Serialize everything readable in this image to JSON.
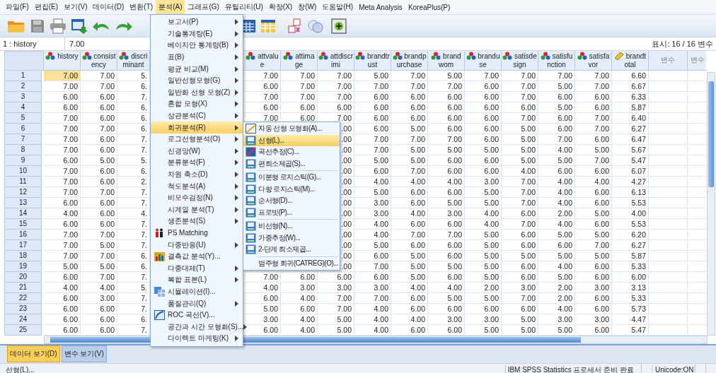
{
  "menubar": [
    {
      "label": "파일(F)",
      "selected": false
    },
    {
      "label": "편집(E)",
      "selected": false
    },
    {
      "label": "보기(V)",
      "selected": false
    },
    {
      "label": "데이터(D)",
      "selected": false
    },
    {
      "label": "변환(T)",
      "selected": false
    },
    {
      "label": "분석(A)",
      "selected": true
    },
    {
      "label": "그래프(G)",
      "selected": false
    },
    {
      "label": "유틸리티(U)",
      "selected": false
    },
    {
      "label": "확장(X)",
      "selected": false
    },
    {
      "label": "창(W)",
      "selected": false
    },
    {
      "label": "도움말(H)",
      "selected": false
    },
    {
      "label": "Meta Analysis",
      "selected": false
    },
    {
      "label": "KoreaPlus(P)",
      "selected": false
    }
  ],
  "cell_editor": {
    "ref": "1 : history",
    "value": "7.00",
    "display_count": "표시: 16 / 16 변수"
  },
  "columns": [
    {
      "label": "history",
      "kind": "nominal"
    },
    {
      "label": "consistency",
      "kind": "nominal"
    },
    {
      "label": "discriminant",
      "kind": "nominal"
    },
    {
      "label": "attvalue",
      "kind": "nominal"
    },
    {
      "label": "attimage",
      "kind": "nominal"
    },
    {
      "label": "attdiscrimi",
      "kind": "nominal"
    },
    {
      "label": "brandtrust",
      "kind": "nominal"
    },
    {
      "label": "brandpurchase",
      "kind": "nominal"
    },
    {
      "label": "brandwom",
      "kind": "nominal"
    },
    {
      "label": "branduse",
      "kind": "nominal"
    },
    {
      "label": "satisdesign",
      "kind": "nominal"
    },
    {
      "label": "satisfunction",
      "kind": "nominal"
    },
    {
      "label": "satisfavor",
      "kind": "nominal"
    },
    {
      "label": "brandtotal",
      "kind": "scale"
    },
    {
      "label": "변수",
      "kind": "empty"
    },
    {
      "label": "변수",
      "kind": "empty"
    }
  ],
  "rows": [
    {
      "num": "1",
      "selected": true,
      "cells": [
        "7.00",
        "7.00",
        "5.",
        "7.00",
        "7.00",
        "7.00",
        "5.00",
        "7.00",
        "5.00",
        "7.00",
        "7.00",
        "7.00",
        "7.00",
        "6.60"
      ]
    },
    {
      "num": "2",
      "selected": false,
      "cells": [
        "7.00",
        "7.00",
        "6.",
        "6.00",
        "7.00",
        "7.00",
        "7.00",
        "7.00",
        "7.00",
        "6.00",
        "7.00",
        "5.00",
        "7.00",
        "6.67"
      ]
    },
    {
      "num": "3",
      "selected": false,
      "cells": [
        "6.00",
        "6.00",
        "7.",
        "7.00",
        "7.00",
        "7.00",
        "6.00",
        "6.00",
        "6.00",
        "6.00",
        "7.00",
        "6.00",
        "6.00",
        "6.33"
      ]
    },
    {
      "num": "4",
      "selected": false,
      "cells": [
        "6.00",
        "6.00",
        "6.",
        "6.00",
        "6.00",
        "6.00",
        "6.00",
        "6.00",
        "6.00",
        "6.00",
        "6.00",
        "5.00",
        "6.00",
        "5.87"
      ]
    },
    {
      "num": "5",
      "selected": false,
      "cells": [
        "7.00",
        "6.00",
        "6.",
        "7.00",
        "6.00",
        "7.00",
        "6.00",
        "6.00",
        "6.00",
        "6.00",
        "7.00",
        "6.00",
        "7.00",
        "6.40"
      ]
    },
    {
      "num": "6",
      "selected": false,
      "cells": [
        "7.00",
        "7.00",
        "6.",
        null,
        null,
        ".00",
        "6.00",
        "5.00",
        "6.00",
        "6.00",
        "5.00",
        "6.00",
        "7.00",
        "6.27"
      ]
    },
    {
      "num": "7",
      "selected": false,
      "cells": [
        "7.00",
        "6.00",
        "7.",
        null,
        null,
        ".00",
        "7.00",
        "7.00",
        "7.00",
        "6.00",
        "5.00",
        "7.00",
        "6.00",
        "6.47"
      ]
    },
    {
      "num": "8",
      "selected": false,
      "cells": [
        "7.00",
        "6.00",
        "7.",
        null,
        null,
        ".00",
        "7.00",
        "5.00",
        "5.00",
        "5.00",
        "5.00",
        "4.00",
        "5.00",
        "5.67"
      ]
    },
    {
      "num": "9",
      "selected": false,
      "cells": [
        "6.00",
        "5.00",
        "5.",
        null,
        null,
        ".00",
        "5.00",
        "5.00",
        "6.00",
        "6.00",
        "5.00",
        "5.00",
        "7.00",
        "5.47"
      ]
    },
    {
      "num": "10",
      "selected": false,
      "cells": [
        "7.00",
        "6.00",
        "6.",
        null,
        null,
        ".00",
        "6.00",
        "7.00",
        "6.00",
        "6.00",
        "4.00",
        "6.00",
        "6.00",
        "6.07"
      ]
    },
    {
      "num": "11",
      "selected": false,
      "cells": [
        "7.00",
        "6.00",
        "2.",
        null,
        null,
        ".00",
        "4.00",
        "4.00",
        "4.00",
        "3.00",
        "7.00",
        "4.00",
        "4.00",
        "4.27"
      ]
    },
    {
      "num": "12",
      "selected": false,
      "cells": [
        "7.00",
        "7.00",
        "7.",
        null,
        null,
        ".00",
        "5.00",
        "6.00",
        "6.00",
        "5.00",
        "7.00",
        "4.00",
        "6.00",
        "6.13"
      ]
    },
    {
      "num": "13",
      "selected": false,
      "cells": [
        "6.00",
        "6.00",
        "7.",
        null,
        null,
        ".00",
        "3.00",
        "6.00",
        "5.00",
        "5.00",
        "7.00",
        "4.00",
        "6.00",
        "5.53"
      ]
    },
    {
      "num": "14",
      "selected": false,
      "cells": [
        "4.00",
        "6.00",
        "4.",
        null,
        null,
        ".00",
        "3.00",
        "4.00",
        "3.00",
        "4.00",
        "6.00",
        "2.00",
        "5.00",
        "4.00"
      ]
    },
    {
      "num": "15",
      "selected": false,
      "cells": [
        "6.00",
        "6.00",
        "7.",
        null,
        null,
        ".00",
        "4.00",
        "6.00",
        "6.00",
        "4.00",
        "7.00",
        "4.00",
        "6.00",
        "5.53"
      ]
    },
    {
      "num": "16",
      "selected": false,
      "cells": [
        "7.00",
        "7.00",
        "7.",
        null,
        null,
        ".00",
        "4.00",
        "7.00",
        "7.00",
        "5.00",
        "6.00",
        "5.00",
        "5.00",
        "6.20"
      ]
    },
    {
      "num": "17",
      "selected": false,
      "cells": [
        "7.00",
        "5.00",
        "7.",
        null,
        null,
        ".00",
        "5.00",
        "6.00",
        "6.00",
        "5.00",
        "6.00",
        "6.00",
        "7.00",
        "6.27"
      ]
    },
    {
      "num": "18",
      "selected": false,
      "cells": [
        "7.00",
        "7.00",
        "6.",
        null,
        null,
        ".00",
        "6.00",
        "5.00",
        "6.00",
        "5.00",
        "5.00",
        "5.00",
        "5.00",
        "5.87"
      ]
    },
    {
      "num": "19",
      "selected": false,
      "cells": [
        "5.00",
        "5.00",
        "6.",
        null,
        null,
        ".00",
        "7.00",
        "5.00",
        "5.00",
        "5.00",
        "6.00",
        "4.00",
        "6.00",
        "5.33"
      ]
    },
    {
      "num": "20",
      "selected": false,
      "cells": [
        "6.00",
        "7.00",
        "7.",
        "7.00",
        "6.00",
        "6.00",
        "6.00",
        "5.00",
        "6.00",
        "5.00",
        "6.00",
        "5.00",
        "6.00",
        "6.00"
      ]
    },
    {
      "num": "21",
      "selected": false,
      "cells": [
        "4.00",
        "4.00",
        "5.",
        "4.00",
        "3.00",
        "3.00",
        "3.00",
        "4.00",
        "4.00",
        "2.00",
        "3.00",
        "2.00",
        "3.00",
        "3.13"
      ]
    },
    {
      "num": "22",
      "selected": false,
      "cells": [
        "6.00",
        "3.00",
        "7.",
        "6.00",
        "4.00",
        "7.00",
        "7.00",
        "6.00",
        "5.00",
        "5.00",
        "7.00",
        "2.00",
        "6.00",
        "5.33"
      ]
    },
    {
      "num": "23",
      "selected": false,
      "cells": [
        "6.00",
        "6.00",
        "7.",
        "5.00",
        "6.00",
        "7.00",
        "4.00",
        "6.00",
        "6.00",
        "6.00",
        "6.00",
        "4.00",
        "6.00",
        "5.73"
      ]
    },
    {
      "num": "24",
      "selected": false,
      "cells": [
        "6.00",
        "6.00",
        "6.",
        "3.00",
        "4.00",
        "5.00",
        "4.00",
        "4.00",
        "3.00",
        "3.00",
        "5.00",
        "3.00",
        "3.00",
        "4.47"
      ]
    },
    {
      "num": "25",
      "selected": false,
      "cells": [
        "6.00",
        "6.00",
        "7.",
        "6.00",
        "4.00",
        "5.00",
        "4.00",
        "6.00",
        "6.00",
        "5.00",
        "5.00",
        "5.00",
        "6.00",
        "5.47"
      ]
    }
  ],
  "analyze_menu": [
    {
      "label": "보고서(P)",
      "kind": "submenu",
      "selected": false
    },
    {
      "label": "기술통계량(E)",
      "kind": "submenu",
      "selected": false
    },
    {
      "label": "베이지안 통계량(B)",
      "kind": "submenu",
      "selected": false
    },
    {
      "label": "표(B)",
      "kind": "submenu",
      "selected": false
    },
    {
      "label": "평균 비교(M)",
      "kind": "submenu",
      "selected": false
    },
    {
      "label": "일반선형모형(G)",
      "kind": "submenu",
      "selected": false
    },
    {
      "label": "일반화 선형 모형(Z)",
      "kind": "submenu",
      "selected": false
    },
    {
      "label": "혼합 모형(X)",
      "kind": "submenu",
      "selected": false
    },
    {
      "label": "상관분석(C)",
      "kind": "submenu",
      "selected": false
    },
    {
      "label": "회귀분석(R)",
      "kind": "submenu",
      "selected": true
    },
    {
      "label": "로그선형분석(O)",
      "kind": "submenu",
      "selected": false
    },
    {
      "label": "신경망(W)",
      "kind": "submenu",
      "selected": false
    },
    {
      "label": "분류분석(F)",
      "kind": "submenu",
      "selected": false
    },
    {
      "label": "차원 축소(D)",
      "kind": "submenu",
      "selected": false
    },
    {
      "label": "척도분석(A)",
      "kind": "submenu",
      "selected": false
    },
    {
      "label": "비모수검정(N)",
      "kind": "submenu",
      "selected": false
    },
    {
      "label": "시계열 분석(T)",
      "kind": "submenu",
      "selected": false
    },
    {
      "label": "생존분석(S)",
      "kind": "submenu",
      "selected": false
    },
    {
      "label": "PS Matching",
      "kind": "people",
      "selected": false
    },
    {
      "label": "다중반응(U)",
      "kind": "submenu",
      "selected": false
    },
    {
      "label": "결측값 분석(Y)...",
      "kind": "chart",
      "selected": false
    },
    {
      "label": "다중대체(T)",
      "kind": "submenu",
      "selected": false
    },
    {
      "label": "복합 표본(L)",
      "kind": "submenu",
      "selected": false
    },
    {
      "label": "시뮬레이션(I)...",
      "kind": "grid",
      "selected": false
    },
    {
      "label": "품질관리(Q)",
      "kind": "submenu",
      "selected": false
    },
    {
      "label": "ROC 곡선(V)...",
      "kind": "curve",
      "selected": false
    },
    {
      "label": "공간과 시간 모형화(S)...",
      "kind": "submenu",
      "selected": false
    },
    {
      "label": "다이렉트 마케팅(K)",
      "kind": "submenu",
      "selected": false
    }
  ],
  "regression_menu": [
    {
      "label": "자동 선형 모형화(A)...",
      "kind": "line",
      "separator_before": false,
      "selected": false
    },
    {
      "label": "선형(L)...",
      "kind": "panel",
      "separator_before": false,
      "selected": true
    },
    {
      "label": "곡선추정(C)...",
      "kind": "curve",
      "separator_before": false,
      "selected": false
    },
    {
      "label": "편최소제곱(S)...",
      "kind": "panel",
      "separator_before": false,
      "selected": false
    },
    {
      "label": "이분형 로지스틱(G)...",
      "kind": "panel",
      "separator_before": true,
      "selected": false
    },
    {
      "label": "다항 로지스틱(M)...",
      "kind": "panel",
      "separator_before": false,
      "selected": false
    },
    {
      "label": "순서형(D)...",
      "kind": "panel",
      "separator_before": false,
      "selected": false
    },
    {
      "label": "프로빗(P)...",
      "kind": "panel",
      "separator_before": false,
      "selected": false
    },
    {
      "label": "비선형(N)...",
      "kind": "panel",
      "separator_before": true,
      "selected": false
    },
    {
      "label": "가중추정(W)...",
      "kind": "panel",
      "separator_before": false,
      "selected": false
    },
    {
      "label": "2-단계 최소제곱...",
      "kind": "panel",
      "separator_before": false,
      "selected": false
    },
    {
      "label": "범주형 회귀(CATREG)(O)...",
      "kind": "plain",
      "separator_before": true,
      "selected": false
    }
  ],
  "view_tabs": [
    {
      "label": "데이터 보기(D)",
      "selected": true
    },
    {
      "label": "변수 보기(V)",
      "selected": false
    }
  ],
  "status_bar": {
    "message": "선형(L)...",
    "processor": "IBM SPSS Statistics 프로세서 준비 완료",
    "unicode": "Unicode:ON"
  }
}
